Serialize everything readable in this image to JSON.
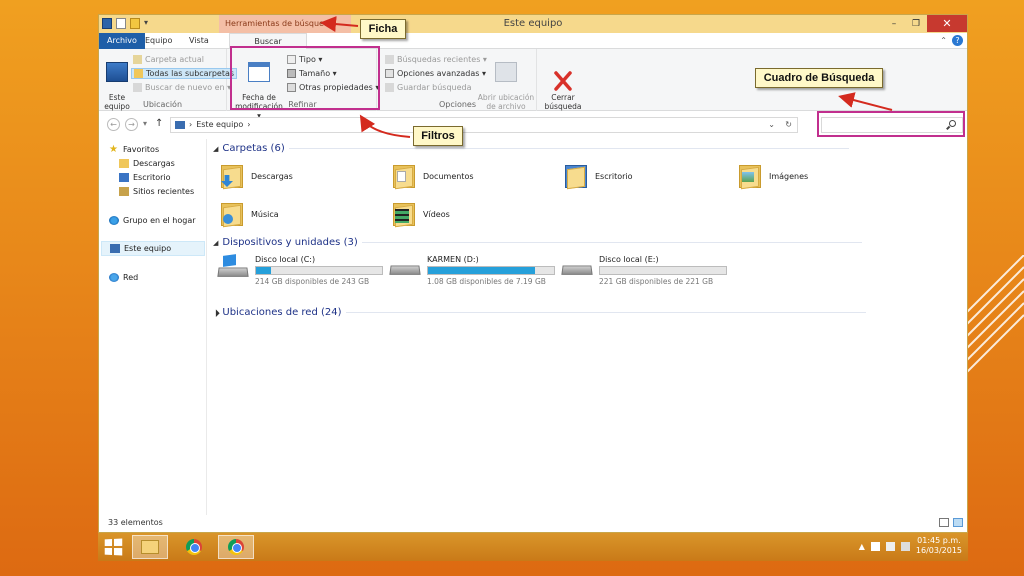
{
  "window": {
    "title": "Este equipo",
    "context_tab": "Herramientas de búsqueda",
    "qat_dropdown": "▾",
    "minimize": "–",
    "maximize": "❐",
    "close": "✕"
  },
  "ribbon_tabs": [
    "Archivo",
    "Equipo",
    "Vista",
    "Buscar"
  ],
  "ribbon_misc": {
    "collapse": "⌃",
    "help": "?"
  },
  "ribbon": {
    "ubicacion": {
      "label": "Ubicación",
      "este_equipo": "Este\nequipo",
      "carpeta_actual": "Carpeta actual",
      "todas_subcarpetas": "Todas las subcarpetas",
      "buscar_de_nuevo": "Buscar de nuevo en ▾"
    },
    "refinar": {
      "label": "Refinar",
      "fecha": "Fecha de\nmodificación ▾",
      "tipo": "Tipo ▾",
      "tamano": "Tamaño ▾",
      "otras": "Otras propiedades ▾"
    },
    "opciones": {
      "label": "Opciones",
      "busquedas_recientes": "Búsquedas recientes ▾",
      "opciones_avanzadas": "Opciones avanzadas ▾",
      "guardar_busqueda": "Guardar búsqueda",
      "abrir_ubicacion": "Abrir ubicación\nde archivo"
    },
    "cerrar": {
      "label": "Cerrar\nbúsqueda"
    }
  },
  "address": {
    "back": "←",
    "forward": "→",
    "recent": "▾",
    "up": "↑",
    "separator": "›",
    "path": "Este equipo",
    "path_arrow": "›",
    "dropdown": "⌄",
    "refresh": "↻",
    "search_placeholder": ""
  },
  "nav": {
    "favoritos": "Favoritos",
    "descargas": "Descargas",
    "escritorio": "Escritorio",
    "sitios": "Sitios recientes",
    "grupo": "Grupo en el hogar",
    "equipo": "Este equipo",
    "red": "Red"
  },
  "content": {
    "carpetas_header": "Carpetas (6)",
    "folders": [
      "Descargas",
      "Documentos",
      "Escritorio",
      "Imágenes",
      "Música",
      "Vídeos"
    ],
    "dispositivos_header": "Dispositivos y unidades (3)",
    "drives": [
      {
        "name": "Disco local (C:)",
        "info": "214 GB disponibles de 243 GB",
        "used": 0.12
      },
      {
        "name": "KARMEN (D:)",
        "info": "1.08 GB disponibles de 7.19 GB",
        "used": 0.85
      },
      {
        "name": "Disco local (E:)",
        "info": "221 GB disponibles de 221 GB",
        "used": 0.0
      }
    ],
    "red_header": "Ubicaciones de red (24)"
  },
  "status": {
    "count": "33 elementos"
  },
  "annotations": {
    "ficha": "Ficha",
    "cuadro": "Cuadro de Búsqueda",
    "filtros": "Filtros"
  },
  "taskbar": {
    "time": "01:45 p.m.",
    "date": "16/03/2015",
    "tray_arrow": "▲"
  },
  "colors": {
    "accent_blue": "#1e5ea8",
    "annotation_border": "#c12f8e",
    "arrow_red": "#d42a1e",
    "drive_fill": "#26a0da"
  }
}
